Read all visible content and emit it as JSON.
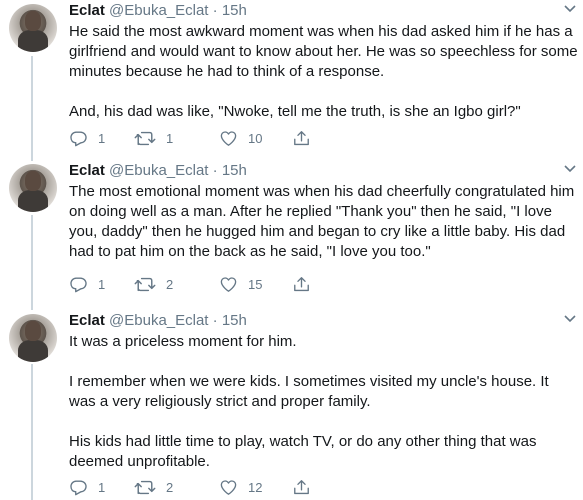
{
  "tweets": [
    {
      "name": "Eclat",
      "handle": "@Ebuka_Eclat",
      "separator": "·",
      "time": "15h",
      "paragraphs": [
        "He said the most awkward moment was when his dad asked him if he has a girlfriend and would want to know about her. He was so speechless for some minutes because he had to think of a response.",
        "And, his dad was like, \"Nwoke, tell me the truth, is she an Igbo girl?\""
      ],
      "replies": "1",
      "retweets": "1",
      "likes": "10"
    },
    {
      "name": "Eclat",
      "handle": "@Ebuka_Eclat",
      "separator": "·",
      "time": "15h",
      "paragraphs": [
        "The most emotional moment was when his dad cheerfully congratulated him on doing well as a man. After he replied \"Thank you\" then he said, \"I love you, daddy\" then he hugged him and began to cry like a little baby. His dad had to pat him on the back as he said, \"I love you too.\""
      ],
      "replies": "1",
      "retweets": "2",
      "likes": "15"
    },
    {
      "name": "Eclat",
      "handle": "@Ebuka_Eclat",
      "separator": "·",
      "time": "15h",
      "paragraphs": [
        "It was a priceless moment for him.",
        "I remember when we were kids. I sometimes visited my uncle's house. It was a very religiously strict and proper family.",
        "His kids had little time to play, watch TV, or do any other thing that was deemed unprofitable."
      ],
      "replies": "1",
      "retweets": "2",
      "likes": "12"
    }
  ],
  "icons": {
    "reply": "reply-icon",
    "retweet": "retweet-icon",
    "like": "heart-icon",
    "share": "share-icon",
    "more": "chevron-down-icon"
  },
  "colors": {
    "text": "#14171a",
    "muted": "#657786",
    "thread_line": "#ccd6dd"
  }
}
